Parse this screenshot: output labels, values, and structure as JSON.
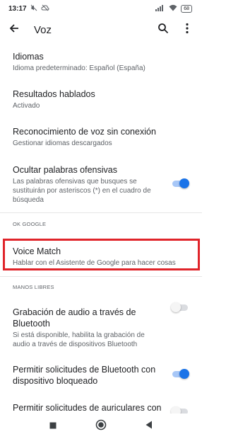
{
  "status_bar": {
    "time": "13:17",
    "battery": "68"
  },
  "app_bar": {
    "title": "Voz"
  },
  "items": [
    {
      "title": "Idiomas",
      "subtitle": "Idioma predeterminado: Español (España)"
    },
    {
      "title": "Resultados hablados",
      "subtitle": "Activado"
    },
    {
      "title": "Reconocimiento de voz sin conexión",
      "subtitle": "Gestionar idiomas descargados"
    },
    {
      "title": "Ocultar palabras ofensivas",
      "subtitle": "Las palabras ofensivas que busques se sustituirán por asteriscos (*) en el cuadro de búsqueda",
      "toggle": "on"
    }
  ],
  "sections": {
    "ok_google": {
      "header": "OK GOOGLE",
      "items": [
        {
          "title": "Voice Match",
          "subtitle": "Hablar con el Asistente de Google para hacer cosas"
        }
      ]
    },
    "manos_libres": {
      "header": "MANOS LIBRES",
      "items": [
        {
          "title": "Grabación de audio a través de Bluetooth",
          "subtitle": "Si está disponible, habilita la grabación de audio a través de dispositivos Bluetooth",
          "toggle": "off"
        },
        {
          "title": "Permitir solicitudes de Bluetooth con dispositivo bloqueado",
          "subtitle": "",
          "toggle": "on"
        },
        {
          "title": "Permitir solicitudes de auriculares con",
          "subtitle": "",
          "toggle": "off"
        }
      ]
    }
  },
  "icons": {
    "back": "arrow-left-icon",
    "search": "search-icon",
    "more": "more-vert-icon",
    "nav_recents": "square-icon",
    "nav_home": "circle-icon",
    "nav_back": "triangle-icon"
  },
  "colors": {
    "accent": "#1a73e8",
    "highlight": "#e0242a"
  }
}
